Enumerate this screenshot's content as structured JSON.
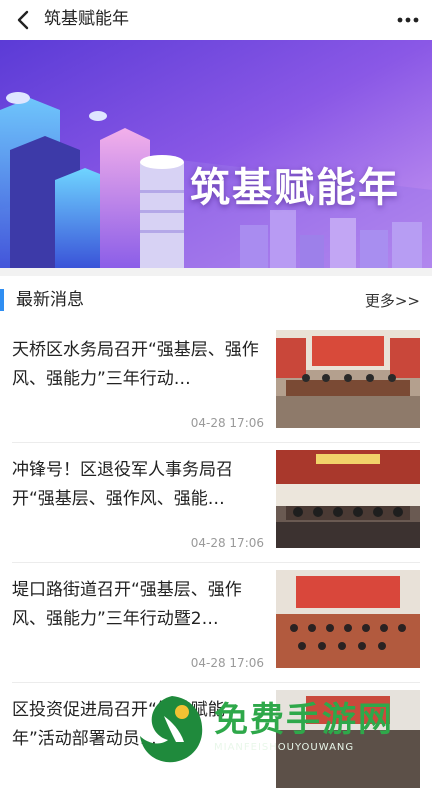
{
  "header": {
    "title": "筑基赋能年",
    "back_icon": "chevron-left-icon",
    "more_icon": "more-dots-icon"
  },
  "banner": {
    "title": "筑基赋能年"
  },
  "section": {
    "title": "最新消息",
    "more": "更多>>"
  },
  "news": [
    {
      "title": "天桥区水务局召开“强基层、强作风、强能力”三年行动…",
      "time": "04-28 17:06"
    },
    {
      "title": "冲锋号！区退役军人事务局召开“强基层、强作风、强能…",
      "time": "04-28 17:06"
    },
    {
      "title": "堤口路街道召开“强基层、强作风、强能力”三年行动暨2…",
      "time": "04-28 17:06"
    },
    {
      "title": "区投资促进局召开“筑基赋能年”活动部署动员…",
      "time": ""
    }
  ],
  "watermark": {
    "text": "免费手游网",
    "sub": "MIANFEISHOUYOUWANG"
  },
  "colors": {
    "accent": "#2f8ef2",
    "banner_purple": "#7b4fe0"
  }
}
